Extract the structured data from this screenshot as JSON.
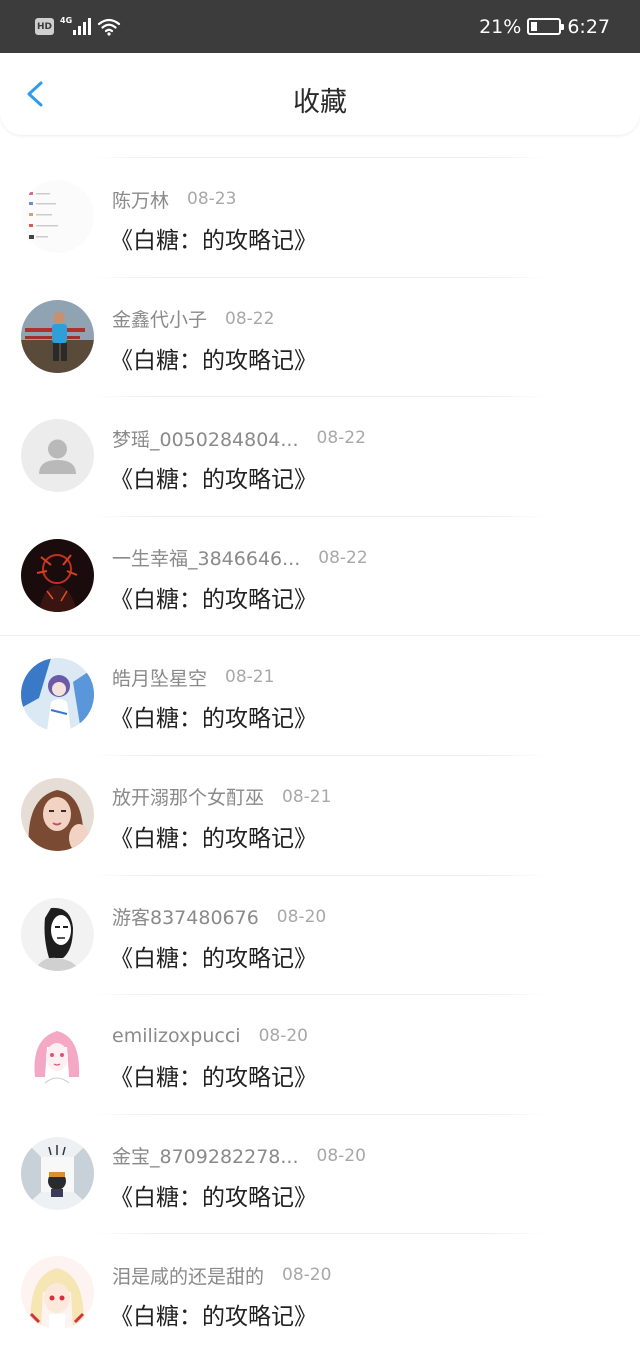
{
  "status_bar": {
    "hd_label": "HD",
    "network_label": "4G",
    "battery_percent": "21%",
    "battery_level": 0.21,
    "time": "6:27"
  },
  "header": {
    "title": "收藏",
    "back_icon": "chevron-left-icon",
    "accent_color": "#2e9bf0"
  },
  "favorites": [
    {
      "user": "陈万林",
      "date": "08-23",
      "title": "《白糖：的攻略记》"
    },
    {
      "user": "金鑫代小子",
      "date": "08-22",
      "title": "《白糖：的攻略记》"
    },
    {
      "user": "梦瑶_0050284804...",
      "date": "08-22",
      "title": "《白糖：的攻略记》"
    },
    {
      "user": "一生幸福_3846646...",
      "date": "08-22",
      "title": "《白糖：的攻略记》"
    },
    {
      "user": "皓月坠星空",
      "date": "08-21",
      "title": "《白糖：的攻略记》"
    },
    {
      "user": "放开溺那个女酊巫",
      "date": "08-21",
      "title": "《白糖：的攻略记》"
    },
    {
      "user": "游客837480676",
      "date": "08-20",
      "title": "《白糖：的攻略记》"
    },
    {
      "user": "emilizoxpucci",
      "date": "08-20",
      "title": "《白糖：的攻略记》"
    },
    {
      "user": "金宝_8709282278...",
      "date": "08-20",
      "title": "《白糖：的攻略记》"
    },
    {
      "user": "泪是咸的还是甜的",
      "date": "08-20",
      "title": "《白糖：的攻略记》"
    }
  ]
}
